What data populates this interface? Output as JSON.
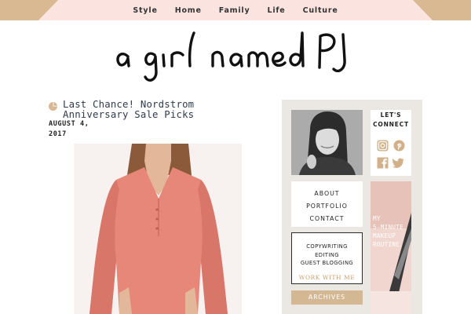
{
  "nav": {
    "items": [
      "Style",
      "Home",
      "Family",
      "Life",
      "Culture"
    ]
  },
  "logo": {
    "text": "a girl named PJ"
  },
  "post": {
    "title": "Last Chance! Nordstrom Anniversary Sale Picks",
    "date_line1": "AUGUST 4,",
    "date_line2": "2017"
  },
  "sidebar": {
    "connect_line1": "LET'S",
    "connect_line2": "CONNECT",
    "social_icons": [
      "instagram-icon",
      "pinterest-icon",
      "facebook-icon",
      "twitter-icon"
    ],
    "menu": [
      "ABOUT",
      "PORTFOLIO",
      "CONTACT"
    ],
    "services": [
      "COPYWRITING",
      "EDITING",
      "GUEST BLOGGING"
    ],
    "services_cta": "WORK WITH ME",
    "archives": "ARCHIVES",
    "makeup_line1": "MY",
    "makeup_line2": "5-MINUTE",
    "makeup_line3": "MAKEUP",
    "makeup_line4": "ROUTINE"
  },
  "colors": {
    "topbar": "#fbe4e0",
    "accent_tan": "#d9b992",
    "sidebar_bg": "#ebe8e3",
    "blouse": "#e6877a",
    "title_text": "#2f3a4c"
  }
}
